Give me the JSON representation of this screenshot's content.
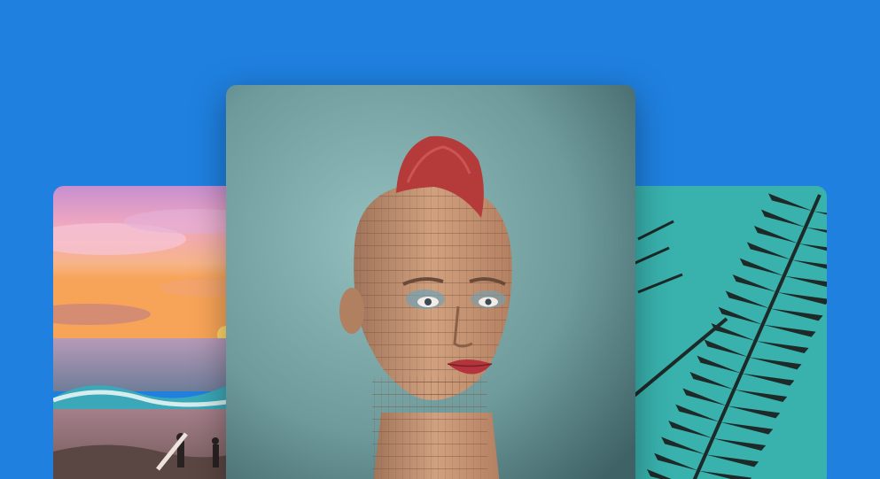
{
  "background_color": "#1f80e0",
  "images": [
    {
      "id": "left",
      "subject": "sunset-beach-photo"
    },
    {
      "id": "center",
      "subject": "sculpted-voxel-head-photo"
    },
    {
      "id": "right",
      "subject": "palm-leaves-photo"
    }
  ],
  "colors": {
    "center_bg": "#6f9b9c",
    "right_bg": "#39b1ad",
    "mohawk": "#b53a3a"
  }
}
